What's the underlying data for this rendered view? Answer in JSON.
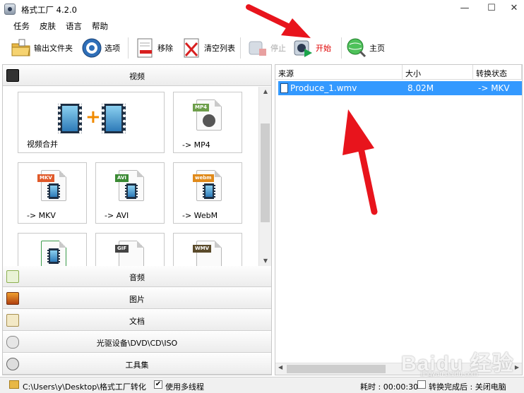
{
  "window": {
    "title": "格式工厂 4.2.0",
    "minimize": "—",
    "maximize": "☐",
    "close": "✕"
  },
  "menu": [
    "任务",
    "皮肤",
    "语言",
    "帮助"
  ],
  "toolbar": {
    "output_folder": "输出文件夹",
    "options": "选项",
    "remove": "移除",
    "clear_list": "清空列表",
    "stop": "停止",
    "start": "开始",
    "home": "主页",
    "start_color": "#e00000"
  },
  "categories": {
    "video": "视频",
    "audio": "音频",
    "image": "图片",
    "document": "文档",
    "disc": "光驱设备\\DVD\\CD\\ISO",
    "tools": "工具集"
  },
  "video_tiles": [
    {
      "label": "视频合并"
    },
    {
      "label": "-> MP4",
      "tag": "MP4"
    },
    {
      "label": "-> MKV",
      "tag": "MKV"
    },
    {
      "label": "-> AVI",
      "tag": "AVI"
    },
    {
      "label": "-> WebM",
      "tag": "webm"
    },
    {
      "label": "",
      "tag": ""
    },
    {
      "label": "",
      "tag": "GIF"
    },
    {
      "label": "",
      "tag": "WMV"
    }
  ],
  "file_list": {
    "columns": [
      "来源",
      "大小",
      "转换状态"
    ],
    "rows": [
      {
        "source": "Produce_1.wmv",
        "size": "8.02M",
        "status": "-> MKV"
      }
    ]
  },
  "status_bar": {
    "output_path": "C:\\Users\\y\\Desktop\\格式工厂转化",
    "multithread_label": "使用多线程",
    "multithread_checked": "✔",
    "elapsed": "耗时 : 00:00:30",
    "after_convert": "转换完成后 : 关闭电脑"
  },
  "watermark": {
    "text": "Baidu 经验",
    "sub": "jingyan.baidu.com"
  }
}
